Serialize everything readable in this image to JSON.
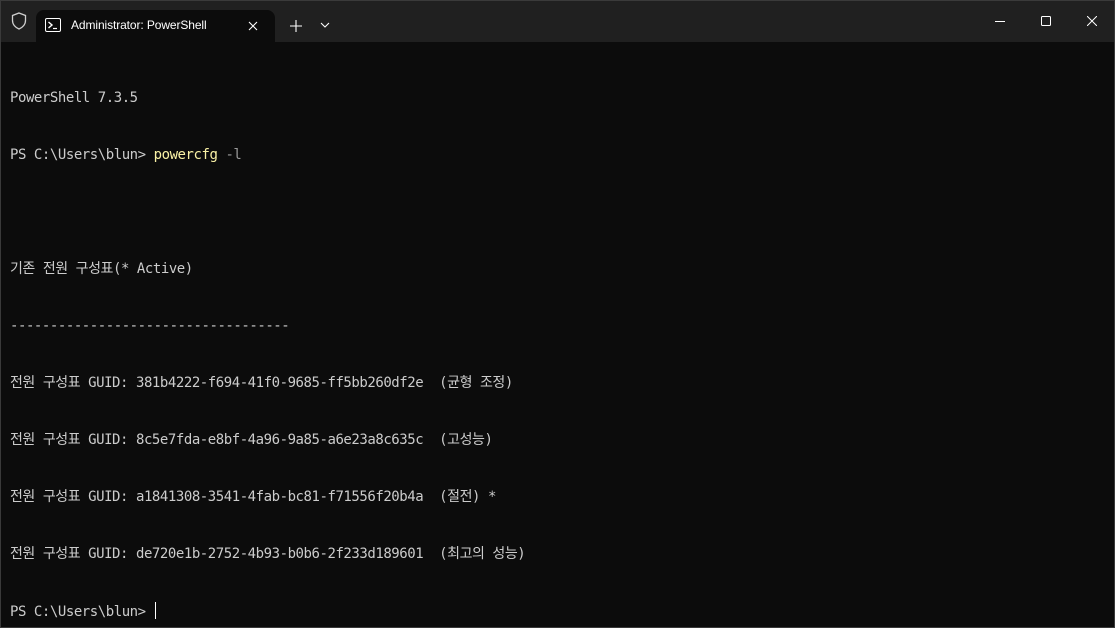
{
  "window": {
    "tab_title": "Administrator: PowerShell"
  },
  "terminal": {
    "version_line": "PowerShell 7.3.5",
    "prompt": "PS C:\\Users\\blun> ",
    "command": "powercfg",
    "command_args": " -l",
    "blank": "",
    "header": "기존 전원 구성표(* Active)",
    "separator": "-----------------------------------",
    "schemes": [
      "전원 구성표 GUID: 381b4222-f694-41f0-9685-ff5bb260df2e  (균형 조정)",
      "전원 구성표 GUID: 8c5e7fda-e8bf-4a96-9a85-a6e23a8c635c  (고성능)",
      "전원 구성표 GUID: a1841308-3541-4fab-bc81-f71556f20b4a  (절전) *",
      "전원 구성표 GUID: de720e1b-2752-4b93-b0b6-2f233d189601  (최고의 성능)"
    ],
    "final_prompt": "PS C:\\Users\\blun> "
  },
  "colors": {
    "background": "#0c0c0c",
    "titlebar": "#202020",
    "text": "#cccccc",
    "command": "#f9f1a5",
    "parameter": "#9a9a9a"
  },
  "icons": {
    "shield": "shield-icon",
    "tab": "powershell-icon",
    "tab_close": "close-icon",
    "new_tab": "plus-icon",
    "dropdown": "chevron-down-icon",
    "minimize": "minimize-icon",
    "maximize": "maximize-icon",
    "close": "close-icon"
  }
}
